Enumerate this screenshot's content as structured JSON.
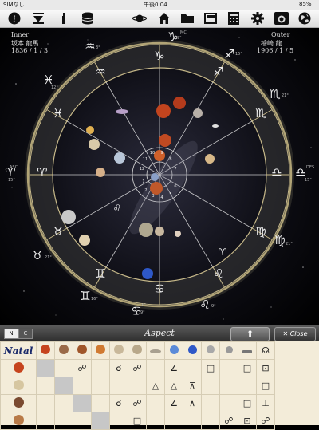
{
  "status": {
    "carrier": "SIMなし",
    "time": "午後0:04",
    "battery": "85%"
  },
  "toolbar": {
    "icons": [
      "info-icon",
      "sort-icon",
      "pin-icon",
      "database-icon",
      "planet-icon",
      "home-icon",
      "folder-icon",
      "window-icon",
      "calculator-icon",
      "gear-icon",
      "camera-icon",
      "globe-icon"
    ]
  },
  "inner": {
    "label": "Inner",
    "name": "坂本 龍馬",
    "date": "1836 / 1 / 3"
  },
  "outer": {
    "label": "Outer",
    "name": "檜崎 龍",
    "date": "1906 / 1 / 5"
  },
  "angles": {
    "mc": "MC",
    "mc_deg": "9°",
    "asc": "ASC",
    "asc_deg": "15°",
    "des": "DES",
    "des_deg": "15°",
    "ic": "IC",
    "ic_deg": "9°"
  },
  "outer_signs": [
    {
      "glyph": "♑",
      "deg": "9°"
    },
    {
      "glyph": "♐",
      "deg": "15°"
    },
    {
      "glyph": "♏",
      "deg": "21°"
    },
    {
      "glyph": "♎",
      "deg": "15°"
    },
    {
      "glyph": "♍",
      "deg": "21°"
    },
    {
      "glyph": "♌",
      "deg": "9°"
    },
    {
      "glyph": "♋",
      "deg": "9°"
    },
    {
      "glyph": "♊",
      "deg": "16°"
    },
    {
      "glyph": "♉",
      "deg": "21°"
    },
    {
      "glyph": "♈",
      "deg": "15°"
    },
    {
      "glyph": "♓",
      "deg": "12°"
    },
    {
      "glyph": "♒",
      "deg": "3°"
    }
  ],
  "ring_signs": [
    "♑",
    "♐",
    "♏",
    "♎",
    "♍",
    "♌",
    "♋",
    "♊",
    "♉",
    "♈",
    "♓",
    "♒"
  ],
  "house_numbers": [
    "1",
    "2",
    "3",
    "4",
    "5",
    "6",
    "7",
    "8",
    "9",
    "10",
    "11",
    "12"
  ],
  "aspect_bar": {
    "tab_n": "N",
    "tab_c": "C",
    "title": "Aspect",
    "up": "⬆",
    "close": "✕ Close"
  },
  "grid": {
    "title": "Natal",
    "header_glyphs": [
      "☉",
      "☽",
      "☿",
      "♀",
      "♂",
      "♃",
      "♄",
      "♅",
      "♆",
      "♇",
      "⚷",
      "⚸",
      "☊"
    ],
    "rows": [
      {
        "cells": [
          "",
          "",
          "☍",
          "",
          "☌",
          "☍",
          "",
          "∠",
          "",
          "□",
          "",
          "□",
          "⊡"
        ]
      },
      {
        "cells": [
          "",
          "",
          "",
          "",
          "",
          "",
          "△",
          "△",
          "⊼",
          "",
          "",
          "",
          "□"
        ]
      },
      {
        "cells": [
          "",
          "",
          "",
          "",
          "☌",
          "☍",
          "",
          "∠",
          "⊼",
          "",
          "",
          "□",
          "⊥"
        ]
      },
      {
        "cells": [
          "",
          "",
          "",
          "",
          "",
          "□",
          "",
          "",
          "",
          "",
          "☍",
          "⊡",
          "☍"
        ]
      }
    ]
  },
  "colors": {
    "accent": "#1a2a6a",
    "ring": "#c7b98a",
    "grid_bg": "#f3ecd9"
  }
}
